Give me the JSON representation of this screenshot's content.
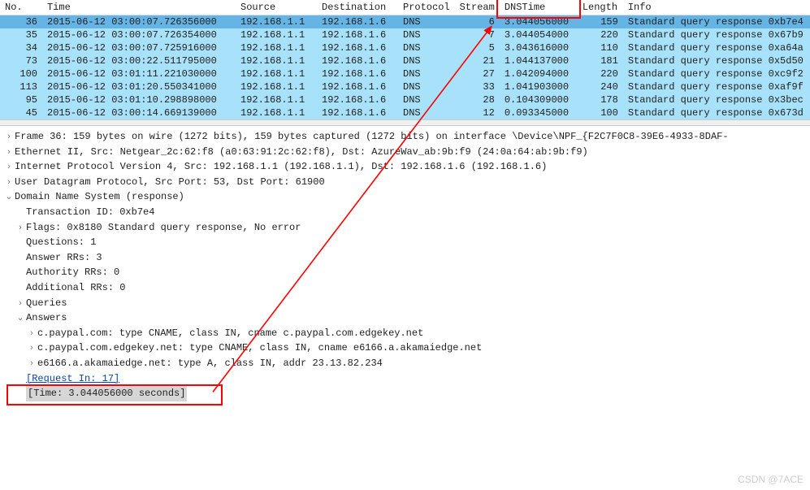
{
  "columns": [
    "No.",
    "Time",
    "Source",
    "Destination",
    "Protocol",
    "Stream",
    "DNSTime",
    "Length",
    "Info"
  ],
  "rows": [
    {
      "no": "36",
      "time": "2015-06-12 03:00:07.726356000",
      "src": "192.168.1.1",
      "dst": "192.168.1.6",
      "proto": "DNS",
      "stream": "6",
      "dnstime": "3.044056000",
      "length": "159",
      "info": "Standard query response 0xb7e4",
      "selected": true
    },
    {
      "no": "35",
      "time": "2015-06-12 03:00:07.726354000",
      "src": "192.168.1.1",
      "dst": "192.168.1.6",
      "proto": "DNS",
      "stream": "7",
      "dnstime": "3.044054000",
      "length": "220",
      "info": "Standard query response 0x67b9"
    },
    {
      "no": "34",
      "time": "2015-06-12 03:00:07.725916000",
      "src": "192.168.1.1",
      "dst": "192.168.1.6",
      "proto": "DNS",
      "stream": "5",
      "dnstime": "3.043616000",
      "length": "110",
      "info": "Standard query response 0xa64a"
    },
    {
      "no": "73",
      "time": "2015-06-12 03:00:22.511795000",
      "src": "192.168.1.1",
      "dst": "192.168.1.6",
      "proto": "DNS",
      "stream": "21",
      "dnstime": "1.044137000",
      "length": "181",
      "info": "Standard query response 0x5d50"
    },
    {
      "no": "100",
      "time": "2015-06-12 03:01:11.221030000",
      "src": "192.168.1.1",
      "dst": "192.168.1.6",
      "proto": "DNS",
      "stream": "27",
      "dnstime": "1.042094000",
      "length": "220",
      "info": "Standard query response 0xc9f2"
    },
    {
      "no": "113",
      "time": "2015-06-12 03:01:20.550341000",
      "src": "192.168.1.1",
      "dst": "192.168.1.6",
      "proto": "DNS",
      "stream": "33",
      "dnstime": "1.041903000",
      "length": "240",
      "info": "Standard query response 0xaf9f"
    },
    {
      "no": "95",
      "time": "2015-06-12 03:01:10.298898000",
      "src": "192.168.1.1",
      "dst": "192.168.1.6",
      "proto": "DNS",
      "stream": "28",
      "dnstime": "0.104309000",
      "length": "178",
      "info": "Standard query response 0x3bec"
    },
    {
      "no": "45",
      "time": "2015-06-12 03:00:14.669139000",
      "src": "192.168.1.1",
      "dst": "192.168.1.6",
      "proto": "DNS",
      "stream": "12",
      "dnstime": "0.093345000",
      "length": "100",
      "info": "Standard query response 0x673d"
    }
  ],
  "details": {
    "frame": "Frame 36: 159 bytes on wire (1272 bits), 159 bytes captured (1272 bits) on interface \\Device\\NPF_{F2C7F0C8-39E6-4933-8DAF-",
    "eth": "Ethernet II, Src: Netgear_2c:62:f8 (a0:63:91:2c:62:f8), Dst: AzureWav_ab:9b:f9 (24:0a:64:ab:9b:f9)",
    "ip": "Internet Protocol Version 4, Src: 192.168.1.1 (192.168.1.1), Dst: 192.168.1.6 (192.168.1.6)",
    "udp": "User Datagram Protocol, Src Port: 53, Dst Port: 61900",
    "dns_header": "Domain Name System (response)",
    "txid": "Transaction ID: 0xb7e4",
    "flags": "Flags: 0x8180 Standard query response, No error",
    "questions": "Questions: 1",
    "answer_rrs": "Answer RRs: 3",
    "authority_rrs": "Authority RRs: 0",
    "additional_rrs": "Additional RRs: 0",
    "queries": "Queries",
    "answers_header": "Answers",
    "answers": [
      "c.paypal.com: type CNAME, class IN, cname c.paypal.com.edgekey.net",
      "c.paypal.com.edgekey.net: type CNAME, class IN, cname e6166.a.akamaiedge.net",
      "e6166.a.akamaiedge.net: type A, class IN, addr 23.13.82.234"
    ],
    "request_in": "[Request In: 17]",
    "time_field": "[Time: 3.044056000 seconds]"
  },
  "watermark": "CSDN @7ACE"
}
